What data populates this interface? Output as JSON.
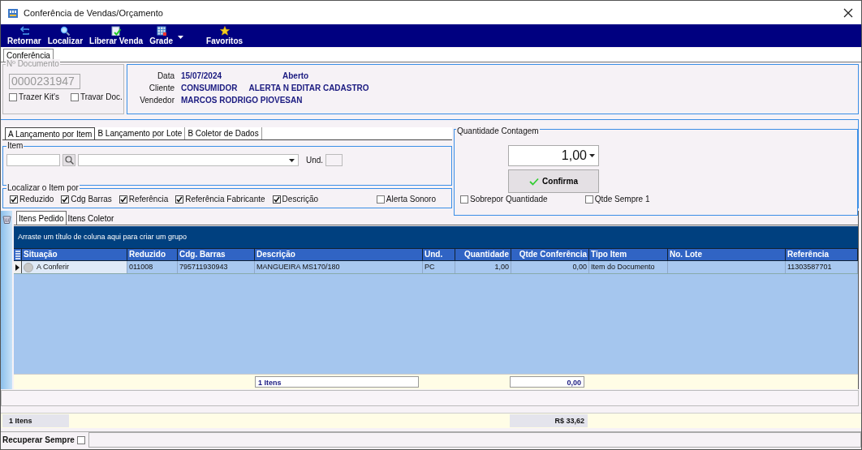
{
  "window": {
    "title": "Conferência de Vendas/Orçamento"
  },
  "toolbar": [
    {
      "label": "Retornar",
      "dropdown": false
    },
    {
      "label": "Localizar",
      "dropdown": false
    },
    {
      "label": "Liberar Venda",
      "dropdown": false
    },
    {
      "label": "Grade",
      "dropdown": true
    },
    {
      "label": "Favoritos",
      "dropdown": false
    }
  ],
  "page_tabs": [
    {
      "label": "Conferência",
      "selected": true
    }
  ],
  "document": {
    "legend": "Nº Documento",
    "number": "0000231947",
    "options": [
      {
        "label": "Trazer Kit's",
        "checked": false
      },
      {
        "label": "Travar Doc.",
        "checked": false
      }
    ]
  },
  "info": [
    {
      "label": "Data",
      "value": "15/07/2024",
      "extra": "Aberto"
    },
    {
      "label": "Cliente",
      "value": "CONSUMIDOR",
      "extra": "ALERTA N EDITAR CADASTRO"
    },
    {
      "label": "Vendedor",
      "value": "MARCOS RODRIGO PIOVESAN"
    }
  ],
  "entry_tabs": [
    {
      "label": "A Lançamento por Item",
      "selected": true
    },
    {
      "label": "B Lançamento por Lote",
      "selected": false
    },
    {
      "label": "B Coletor de Dados",
      "selected": false
    }
  ],
  "item": {
    "legend": "Item",
    "unit_label": "Und."
  },
  "search_by": {
    "legend": "Localizar o Item por",
    "options": [
      {
        "label": "Reduzido",
        "checked": true
      },
      {
        "label": "Cdg Barras",
        "checked": true
      },
      {
        "label": "Referência",
        "checked": true
      },
      {
        "label": "Referência Fabricante",
        "checked": true
      },
      {
        "label": "Descrição",
        "checked": true
      }
    ],
    "alert": {
      "label": "Alerta Sonoro",
      "checked": false
    }
  },
  "quantity": {
    "legend": "Quantidade Contagem",
    "value": "1,00",
    "confirm": "Confirma",
    "options": [
      {
        "label": "Sobrepor Quantidade",
        "checked": false
      },
      {
        "label": "Qtde Sempre 1",
        "checked": false
      }
    ]
  },
  "grid_tabs": [
    {
      "label": "Itens Pedido",
      "selected": true
    },
    {
      "label": "Itens Coletor",
      "selected": false
    }
  ],
  "grid": {
    "group_hint": "Arraste um título de coluna aqui para criar um grupo",
    "columns": [
      {
        "label": "Situação"
      },
      {
        "label": "Reduzido"
      },
      {
        "label": "Cdg. Barras"
      },
      {
        "label": "Descrição"
      },
      {
        "label": "Und."
      },
      {
        "label": "Quantidade"
      },
      {
        "label": "Qtde Conferência"
      },
      {
        "label": "Tipo Item"
      },
      {
        "label": "No. Lote"
      },
      {
        "label": "Referência"
      }
    ],
    "rows": [
      {
        "selected": true,
        "cells": [
          "A Conferir",
          "011008",
          "795711930943",
          "MANGUEIRA MS170/180",
          "PC",
          "1,00",
          "0,00",
          "Item do Documento",
          "",
          "11303587701"
        ]
      }
    ],
    "footer": {
      "item_count": "1 Itens",
      "checked_total": "0,00"
    }
  },
  "status": {
    "count": "1 Itens",
    "total": "R$ 33,62"
  },
  "recover": {
    "label": "Recuperar Sempre",
    "checked": false
  }
}
